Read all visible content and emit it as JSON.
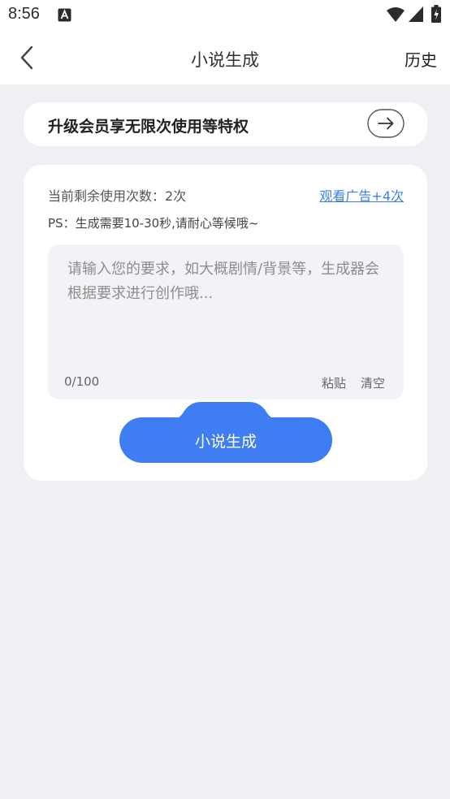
{
  "status_bar": {
    "time": "8:56",
    "notification_icon": "a-letter-icon",
    "wifi_icon": "wifi-icon",
    "signal_icon": "signal-icon",
    "battery_icon": "battery-charging-icon"
  },
  "header": {
    "title": "小说生成",
    "history_label": "历史",
    "back_icon": "chevron-left-icon"
  },
  "vip_banner": {
    "text": "升级会员享无限次使用等特权",
    "arrow_icon": "arrow-right-circle-icon"
  },
  "generator": {
    "remaining_text": "当前剩余使用次数：2次",
    "ad_link": "观看广告+4次",
    "ps_text": "PS：生成需要10-30秒,请耐心等候哦~",
    "input_placeholder": "请输入您的要求，如大概剧情/背景等，生成器会根据要求进行创作哦...",
    "input_value": "",
    "char_count": "0/100",
    "paste_label": "粘贴",
    "clear_label": "清空",
    "generate_label": "小说生成"
  },
  "colors": {
    "accent": "#3f7ef2",
    "link": "#3c7fe6",
    "background": "#eff0f4"
  }
}
